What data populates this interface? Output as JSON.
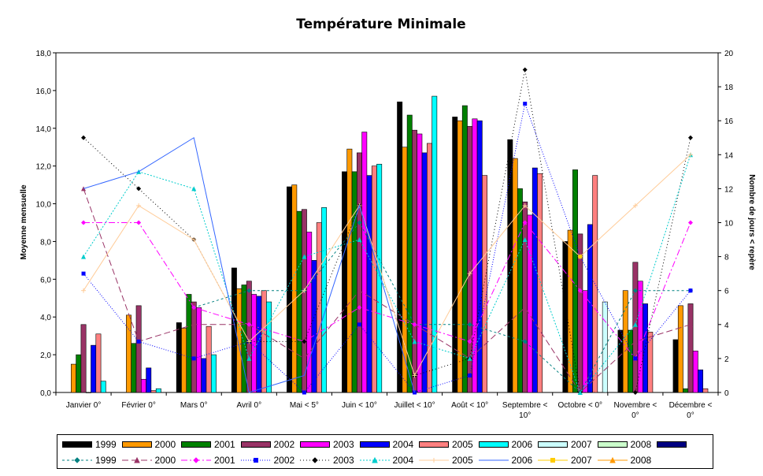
{
  "chart_data": {
    "type": "bar",
    "title": "Température Minimale",
    "ylabel": "Moyenne mensuelle",
    "y2label": "Nombre de jours < repère",
    "ylim": [
      0,
      18
    ],
    "y2lim": [
      0,
      20
    ],
    "yticks": [
      "0,0",
      "2,0",
      "4,0",
      "6,0",
      "8,0",
      "10,0",
      "12,0",
      "14,0",
      "16,0",
      "18,0"
    ],
    "y2ticks": [
      "0",
      "2",
      "4",
      "6",
      "8",
      "10",
      "12",
      "14",
      "16",
      "18",
      "20"
    ],
    "categories": [
      [
        "Janvier 0°"
      ],
      [
        "Février 0°"
      ],
      [
        "Mars 0°"
      ],
      [
        "Avril 0°"
      ],
      [
        "Mai < 5°"
      ],
      [
        "Juin < 10°"
      ],
      [
        "Juillet < 10°"
      ],
      [
        "Août < 10°"
      ],
      [
        "Septembre <",
        "10°"
      ],
      [
        "Octobre < 0°"
      ],
      [
        "Novembre <",
        "0°"
      ],
      [
        "Décembre <",
        "0°"
      ]
    ],
    "series": [
      {
        "name": "1999",
        "color": "#000000",
        "values": [
          null,
          null,
          3.7,
          6.6,
          10.9,
          11.7,
          15.4,
          14.6,
          13.4,
          8.0,
          3.3,
          2.8
        ]
      },
      {
        "name": "2000",
        "color": "#ff9900",
        "values": [
          1.5,
          4.1,
          3.4,
          5.5,
          11.0,
          12.9,
          13.0,
          14.4,
          12.4,
          8.6,
          5.4,
          4.6
        ]
      },
      {
        "name": "2001",
        "color": "#008000",
        "values": [
          2.0,
          2.6,
          5.2,
          5.7,
          9.6,
          11.7,
          14.7,
          15.2,
          10.8,
          11.8,
          3.3,
          0.2
        ]
      },
      {
        "name": "2002",
        "color": "#993366",
        "values": [
          3.6,
          4.6,
          4.8,
          5.9,
          9.7,
          12.7,
          13.9,
          14.1,
          10.1,
          8.4,
          6.9,
          4.7
        ]
      },
      {
        "name": "2003",
        "color": "#ff00ff",
        "values": [
          0.0,
          0.7,
          4.5,
          5.2,
          8.5,
          13.8,
          13.7,
          14.5,
          9.4,
          5.4,
          5.9,
          2.2
        ]
      },
      {
        "name": "2004",
        "color": "#0000ff",
        "values": [
          2.5,
          1.3,
          1.8,
          5.1,
          7.0,
          11.5,
          12.7,
          14.4,
          11.9,
          8.9,
          4.7,
          1.2
        ]
      },
      {
        "name": "2005",
        "color": "#ff8080",
        "values": [
          3.1,
          0.1,
          3.5,
          5.4,
          9.0,
          12.0,
          13.2,
          11.5,
          11.6,
          11.5,
          3.2,
          0.2
        ]
      },
      {
        "name": "2006",
        "color": "#00ffff",
        "values": [
          0.6,
          0.2,
          2.0,
          4.8,
          9.8,
          12.1,
          15.7,
          null,
          null,
          null,
          null,
          null
        ]
      },
      {
        "name": "2007",
        "color": "#ccffff",
        "values": [
          null,
          null,
          null,
          null,
          null,
          null,
          null,
          null,
          null,
          4.8,
          null,
          null
        ]
      },
      {
        "name": "2008",
        "color": "#ccffcc",
        "values": [
          null,
          null,
          null,
          null,
          null,
          null,
          null,
          null,
          null,
          null,
          null,
          null
        ]
      },
      {
        "name": "",
        "color": "#000080",
        "values": [
          null,
          null,
          null,
          null,
          null,
          null,
          null,
          null,
          null,
          null,
          null,
          null
        ]
      }
    ],
    "line_series": [
      {
        "name": "1999",
        "color": "#008080",
        "dash": "3,3",
        "marker": "diamond",
        "values": [
          null,
          null,
          5,
          6,
          6,
          10,
          4,
          4,
          3,
          0,
          6,
          6
        ]
      },
      {
        "name": "2000",
        "color": "#993366",
        "dash": "8,4",
        "marker": "triangle",
        "values": [
          12,
          3,
          4,
          4,
          2,
          6,
          4,
          2,
          5,
          0,
          3,
          4
        ]
      },
      {
        "name": "2001",
        "color": "#ff00ff",
        "dash": "8,3,2,3",
        "marker": "diamond",
        "values": [
          10,
          10,
          5,
          4,
          3,
          5,
          4,
          3,
          10,
          6,
          2,
          10
        ]
      },
      {
        "name": "2002",
        "color": "#0000ff",
        "dash": "1,2",
        "marker": "square",
        "values": [
          7,
          3,
          2,
          3,
          0,
          4,
          0,
          1,
          17,
          8,
          2,
          6
        ]
      },
      {
        "name": "2003",
        "color": "#000000",
        "dash": "1,3",
        "marker": "diamond",
        "values": [
          15,
          12,
          9,
          3,
          3,
          11,
          1,
          2,
          19,
          0,
          0,
          15
        ]
      },
      {
        "name": "2004",
        "color": "#00cccc",
        "dash": "2,2",
        "marker": "triangle",
        "values": [
          8,
          13,
          12,
          2,
          8,
          9,
          3,
          2,
          9,
          0,
          4,
          14
        ]
      },
      {
        "name": "2005",
        "color": "#ffcc99",
        "dash": "",
        "marker": "plus",
        "values": [
          6,
          11,
          9,
          3,
          6,
          11,
          1,
          7,
          11,
          8,
          11,
          14
        ]
      },
      {
        "name": "2006",
        "color": "#3366ff",
        "dash": "",
        "marker": "none",
        "values": [
          12,
          13,
          15,
          0,
          1,
          11,
          0,
          null,
          null,
          null,
          null,
          null
        ]
      },
      {
        "name": "2007",
        "color": "#ffcc00",
        "dash": "",
        "marker": "square",
        "values": [
          null,
          null,
          null,
          null,
          null,
          null,
          null,
          null,
          null,
          8,
          null,
          null
        ]
      },
      {
        "name": "2008",
        "color": "#ff9900",
        "dash": "",
        "marker": "triangle",
        "values": [
          null,
          null,
          null,
          null,
          null,
          null,
          null,
          null,
          null,
          null,
          null,
          null
        ]
      }
    ],
    "grid": false,
    "legend": "bottom"
  }
}
